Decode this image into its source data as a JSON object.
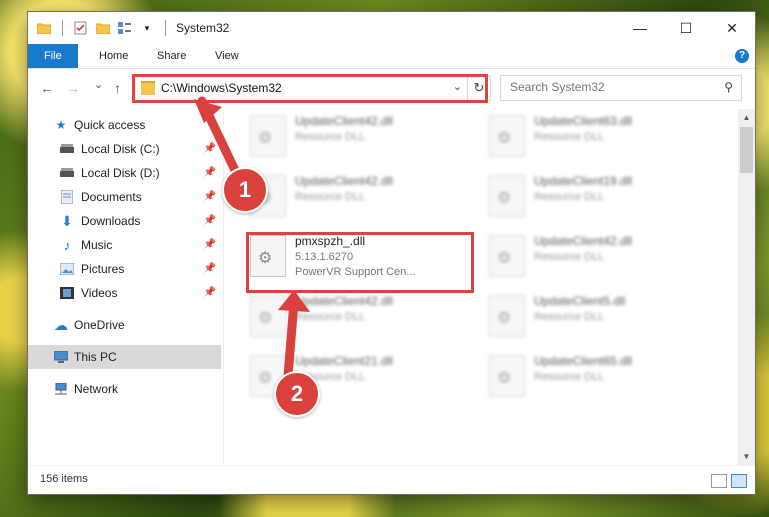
{
  "window": {
    "title": "System32",
    "controls": {
      "minimize": "—",
      "maximize": "☐",
      "close": "✕"
    }
  },
  "ribbon": {
    "tabs": [
      "File",
      "Home",
      "Share",
      "View"
    ],
    "help": "?"
  },
  "nav": {
    "back": "←",
    "forward": "→",
    "recent": "⌄",
    "up": "↑",
    "address": "C:\\Windows\\System32",
    "search_placeholder": "Search System32"
  },
  "sidebar": {
    "items": [
      {
        "label": "Quick access",
        "icon": "star-icon"
      },
      {
        "label": "Local Disk (C:)",
        "icon": "drive-icon",
        "pinned": true
      },
      {
        "label": "Local Disk (D:)",
        "icon": "drive-icon",
        "pinned": true
      },
      {
        "label": "Documents",
        "icon": "documents-icon",
        "pinned": true
      },
      {
        "label": "Downloads",
        "icon": "download-icon",
        "pinned": true
      },
      {
        "label": "Music",
        "icon": "music-icon",
        "pinned": true
      },
      {
        "label": "Pictures",
        "icon": "pictures-icon",
        "pinned": true
      },
      {
        "label": "Videos",
        "icon": "videos-icon",
        "pinned": true
      },
      {
        "label": "OneDrive",
        "icon": "cloud-icon"
      },
      {
        "label": "This PC",
        "icon": "computer-icon",
        "selected": true
      },
      {
        "label": "Network",
        "icon": "network-icon"
      }
    ]
  },
  "files": [
    {
      "name": "UpdateClient42.dll",
      "type": "Resource DLL",
      "blurred": true
    },
    {
      "name": "UpdateClient63.dll",
      "type": "Resource DLL",
      "blurred": true
    },
    {
      "name": "UpdateClient42.dll",
      "type": "Resource DLL",
      "blurred": true
    },
    {
      "name": "UpdateClient19.dll",
      "type": "Resource DLL",
      "blurred": true
    },
    {
      "name": "pmxspzh_.dll",
      "type": "5.13.1.6270",
      "desc": "PowerVR Support Cen...",
      "blurred": false
    },
    {
      "name": "UpdateClient42.dll",
      "type": "Resource DLL",
      "blurred": true
    },
    {
      "name": "UpdateClient42.dll",
      "type": "Resource DLL",
      "blurred": true
    },
    {
      "name": "UpdateClient5.dll",
      "type": "Resource DLL",
      "blurred": true
    },
    {
      "name": "UpdateClient21.dll",
      "type": "Resource DLL",
      "blurred": true
    },
    {
      "name": "UpdateClient65.dll",
      "type": "Resource DLL",
      "blurred": true
    }
  ],
  "status": {
    "count": "156 items"
  },
  "annotations": {
    "step1": "1",
    "step2": "2",
    "color": "#d9413d"
  }
}
